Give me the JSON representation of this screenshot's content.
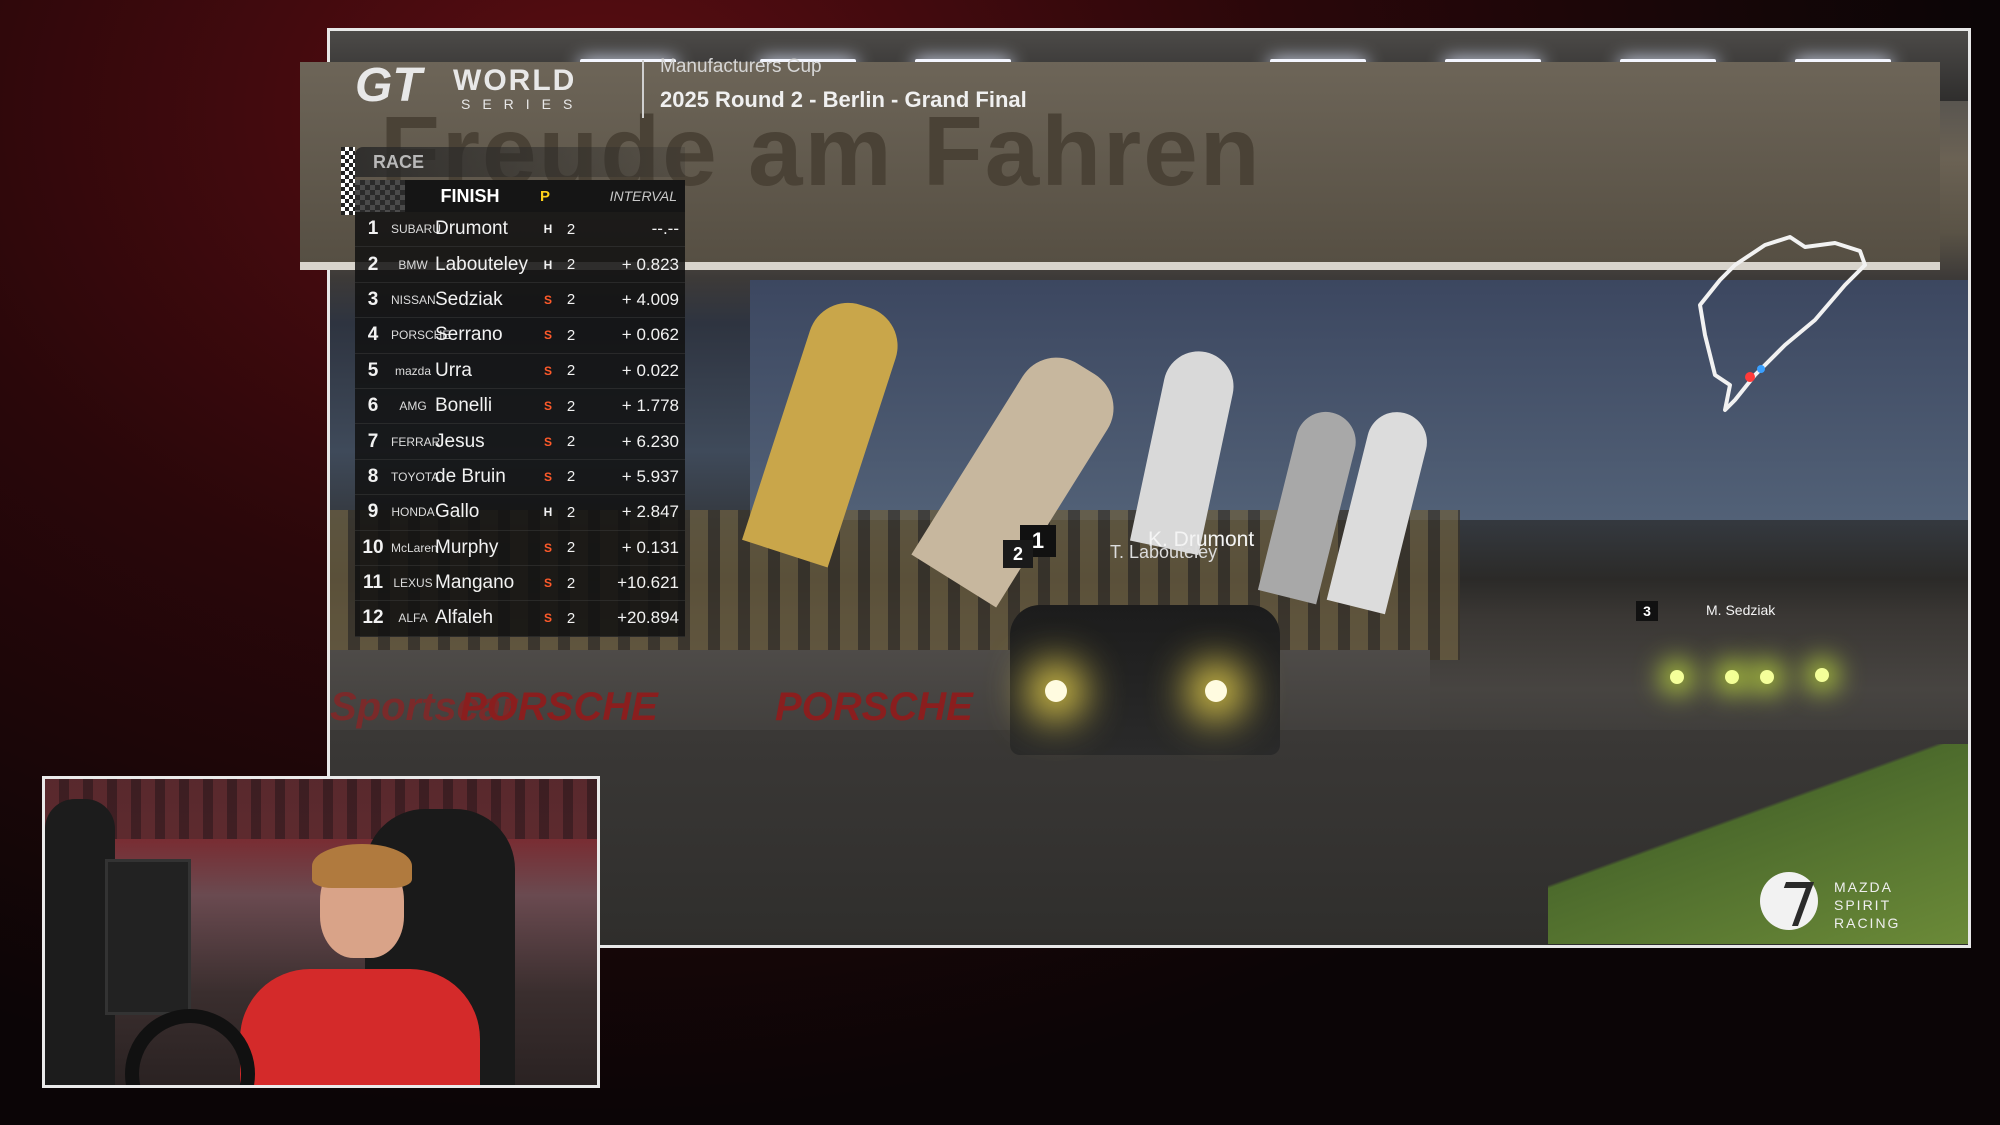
{
  "header": {
    "logo_gt": "GT",
    "logo_world": "WORLD",
    "logo_series": "SERIES",
    "event_sub": "Manufacturers Cup",
    "event_title": "2025 Round 2 - Berlin - Grand Final"
  },
  "scene": {
    "billboard_text": "Freude am Fahren",
    "wall_ads": [
      "Sportscar",
      "PORSCHE",
      "PORSCHE"
    ]
  },
  "board": {
    "race_label": "RACE",
    "finish_label": "FINISH",
    "p_label": "P",
    "interval_label": "INTERVAL",
    "rows": [
      {
        "pos": "1",
        "maker": "SUBARU",
        "name": "Drumont",
        "tyre": "H",
        "laps": "2",
        "gap": "--.--"
      },
      {
        "pos": "2",
        "maker": "BMW",
        "name": "Labouteley",
        "tyre": "H",
        "laps": "2",
        "gap": "+ 0.823"
      },
      {
        "pos": "3",
        "maker": "NISSAN",
        "name": "Sedziak",
        "tyre": "S",
        "laps": "2",
        "gap": "+ 4.009"
      },
      {
        "pos": "4",
        "maker": "PORSCHE",
        "name": "Serrano",
        "tyre": "S",
        "laps": "2",
        "gap": "+ 0.062"
      },
      {
        "pos": "5",
        "maker": "mazda",
        "name": "Urra",
        "tyre": "S",
        "laps": "2",
        "gap": "+ 0.022"
      },
      {
        "pos": "6",
        "maker": "AMG",
        "name": "Bonelli",
        "tyre": "S",
        "laps": "2",
        "gap": "+ 1.778"
      },
      {
        "pos": "7",
        "maker": "FERRARI",
        "name": "Jesus",
        "tyre": "S",
        "laps": "2",
        "gap": "+ 6.230"
      },
      {
        "pos": "8",
        "maker": "TOYOTA",
        "name": "de Bruin",
        "tyre": "S",
        "laps": "2",
        "gap": "+ 5.937"
      },
      {
        "pos": "9",
        "maker": "HONDA",
        "name": "Gallo",
        "tyre": "H",
        "laps": "2",
        "gap": "+ 2.847"
      },
      {
        "pos": "10",
        "maker": "McLaren",
        "name": "Murphy",
        "tyre": "S",
        "laps": "2",
        "gap": "+ 0.131"
      },
      {
        "pos": "11",
        "maker": "LEXUS",
        "name": "Mangano",
        "tyre": "S",
        "laps": "2",
        "gap": "+10.621"
      },
      {
        "pos": "12",
        "maker": "ALFA",
        "name": "Alfaleh",
        "tyre": "S",
        "laps": "2",
        "gap": "+20.894"
      }
    ]
  },
  "track_tags": {
    "p1_num": "1",
    "p1_name": "K. Drumont",
    "p2_num": "2",
    "p2_name": "T. Labouteley",
    "p3_num": "3",
    "p3_name": "M. Sedziak"
  },
  "brand": {
    "line1": "MAZDA",
    "line2": "SPIRIT",
    "line3": "RACING"
  },
  "colors": {
    "soft_tyre": "#ff5a2a",
    "hard_tyre": "#f2f2f2",
    "p_label": "#ffd21a"
  }
}
